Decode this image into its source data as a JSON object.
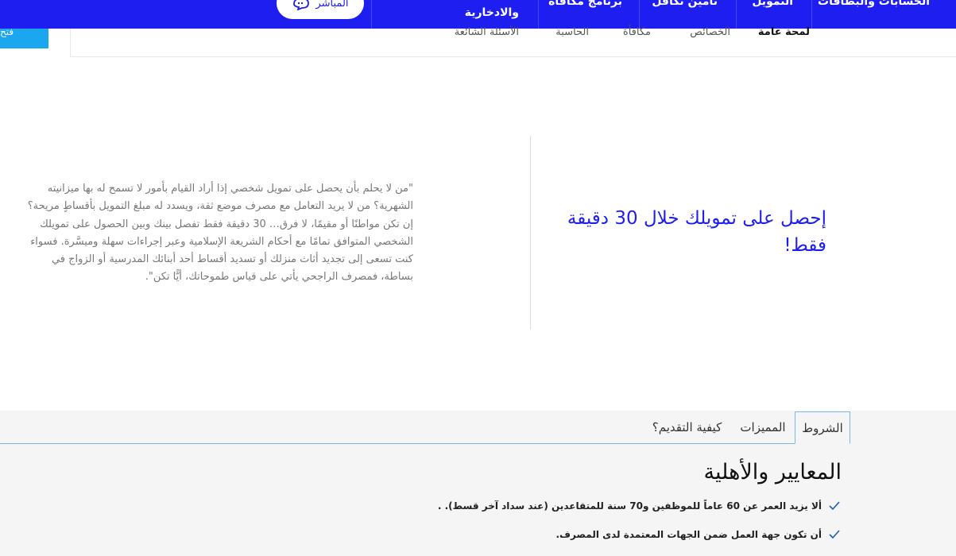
{
  "topnav": {
    "items": [
      {
        "label": "الحسابات والبطاقات"
      },
      {
        "label": "التمويل"
      },
      {
        "label": "تأمين تكافل"
      },
      {
        "label": "برنامج مكافأة"
      },
      {
        "label": "والادخارية"
      }
    ],
    "live_button": "المباشر",
    "open_button": "فتح"
  },
  "subnav": {
    "items": [
      {
        "label": "لمحة عامة"
      },
      {
        "label": "الخصائص"
      },
      {
        "label": "مكافأة"
      },
      {
        "label": "الحاسبة"
      },
      {
        "label": "الأسئلة الشائعة"
      }
    ]
  },
  "hero": {
    "title": "إحصل على تمويلك خلال 30 دقيقة فقط!",
    "quote": "\"من لا يحلم بأن يحصل على تمويل شخصي إذا أراد القيام بأمور لا تسمح له بها ميزانيته الشهرية؟ من لا يريد التعامل مع مصرف موضع ثقة، ويسدد له مبلغ التمويل بأقساطٍ مريحة؟ إن تكن مواطنًا أو مقيمًا، لا فرق… 30 دقيقة فقط تفصل بينك وبين الحصول على تمويلك الشخصي المتوافق تمامًا مع أحكام الشريعة الإسلامية وعبر إجراءات سهلة وميسَّرة. فسواء كنت تسعى إلى تجديد أثاث منزلك أو تسديد أقساط أحد أبنائك المدرسية أو الزواج في بساطة، فمصرف الراجحي يأتي على قياس طموحاتك، أيًّا تكن\"."
  },
  "tabs": {
    "items": [
      {
        "label": "الشروط"
      },
      {
        "label": "المميزات"
      },
      {
        "label": "كيفية التقديم؟"
      }
    ]
  },
  "criteria": {
    "title": "المعايير والأهلية",
    "items": [
      {
        "text": "ألا يزيد العمر عن 60 عاماً للموظفين و70 سنة للمتقاعدين (عند سداد آخر قسط). ."
      },
      {
        "text": "أن تكون جهة العمل ضمن الجهات المعتمدة لدى المصرف."
      }
    ]
  },
  "colors": {
    "brand_blue": "#1e1ef0",
    "accent_cyan": "#1aa7f0",
    "tab_border": "#7cb8e0"
  }
}
